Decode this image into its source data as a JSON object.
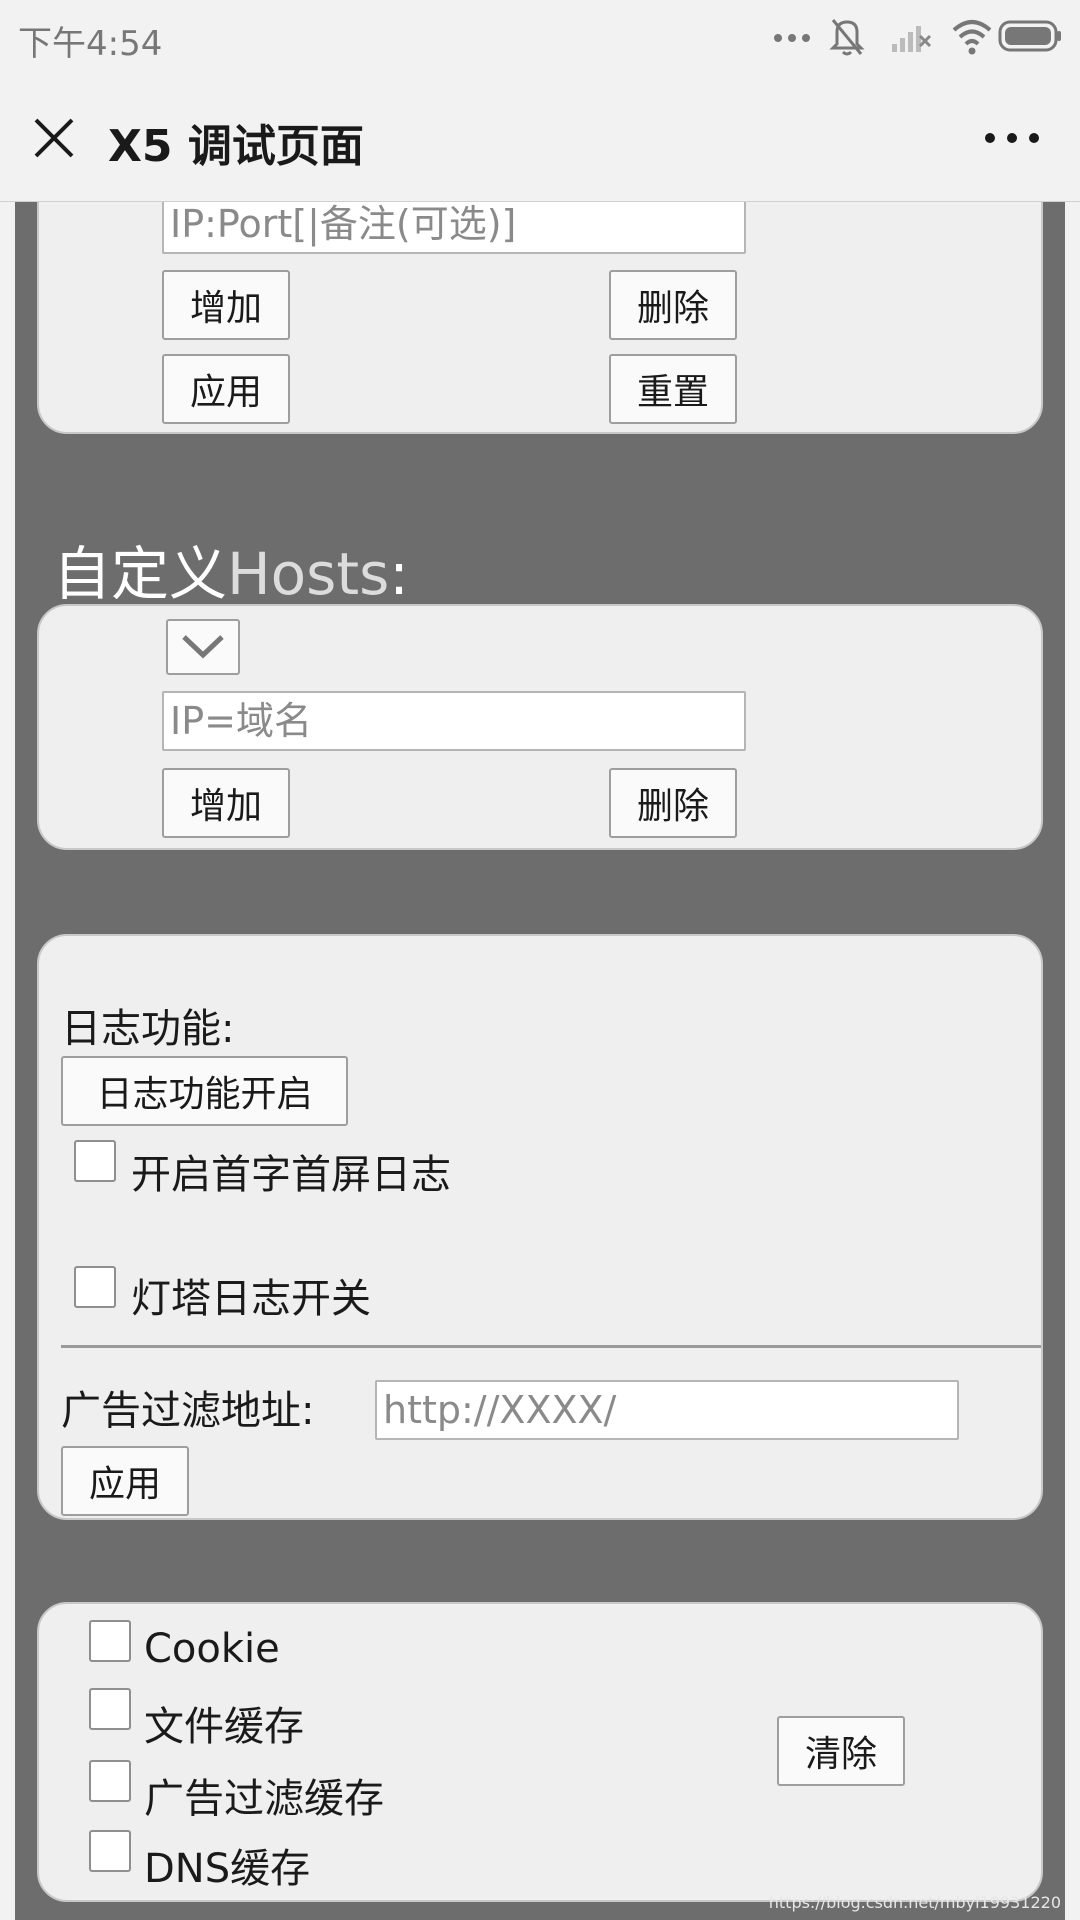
{
  "status_bar": {
    "time": "下午4:54"
  },
  "title_bar": {
    "title": "X5 调试页面"
  },
  "proxy": {
    "input_placeholder": "IP:Port[|备注(可选)]",
    "add_label": "增加",
    "delete_label": "删除",
    "apply_label": "应用",
    "reset_label": "重置"
  },
  "hosts": {
    "title_cn": "自定义",
    "title_en": "Hosts",
    "title_colon": ":",
    "input_placeholder": "IP=域名",
    "add_label": "增加",
    "delete_label": "删除"
  },
  "log": {
    "heading": "日志功能:",
    "enable_button": "日志功能开启",
    "first_screen_log": "开启首字首屏日志",
    "beacon_log": "灯塔日志开关",
    "ad_filter_label": "广告过滤地址:",
    "ad_filter_placeholder": "http://XXXX/",
    "apply_label": "应用"
  },
  "cache": {
    "items": [
      "Cookie",
      "文件缓存",
      "广告过滤缓存",
      "DNS缓存"
    ],
    "clear_label": "清除"
  },
  "watermark": "https://blog.csdn.net/mbyl19931220",
  "colors": {
    "background_dark": "#6d6d6d",
    "panel_bg": "#efefef",
    "bar_bg": "#f2f2f2"
  }
}
